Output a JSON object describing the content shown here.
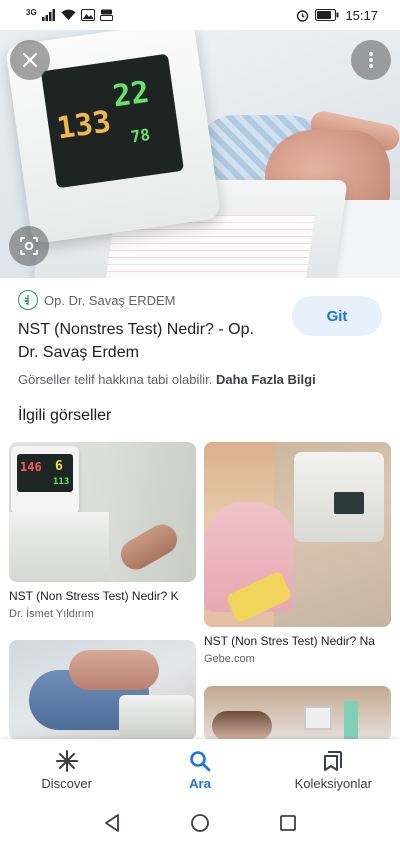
{
  "status_bar": {
    "network": "3G",
    "time": "15:17"
  },
  "hero": {
    "monitor_values": [
      "133",
      "22",
      "78"
    ]
  },
  "result": {
    "source_name": "Op. Dr. Savaş ERDEM",
    "title": "NST (Nonstres Test) Nedir? - Op. Dr. Savaş Erdem",
    "visit_label": "Git",
    "copyright_text": "Görseller telif hakkına tabi olabilir.",
    "more_info_label": "Daha Fazla Bilgi"
  },
  "related": {
    "heading": "İlgili görseller",
    "items": [
      {
        "title": "NST (Non Stress Test) Nedir? K",
        "source": "Dr. İsmet Yıldırım",
        "monitor_values": [
          "146",
          "6",
          "113"
        ]
      },
      {
        "title": "NST (Non Stres Test) Nedir? Na",
        "source": "Gebe.com"
      },
      {
        "title": "",
        "source": ""
      },
      {
        "title": "",
        "source": ""
      }
    ]
  },
  "bottom_nav": {
    "items": [
      {
        "label": "Discover",
        "icon": "asterisk-icon"
      },
      {
        "label": "Ara",
        "icon": "search-icon"
      },
      {
        "label": "Koleksiyonlar",
        "icon": "collections-icon"
      }
    ]
  },
  "colors": {
    "accent": "#1a73e8",
    "visit_bg": "#e8f0fe",
    "text_primary": "#202124",
    "text_secondary": "#5f6368"
  }
}
